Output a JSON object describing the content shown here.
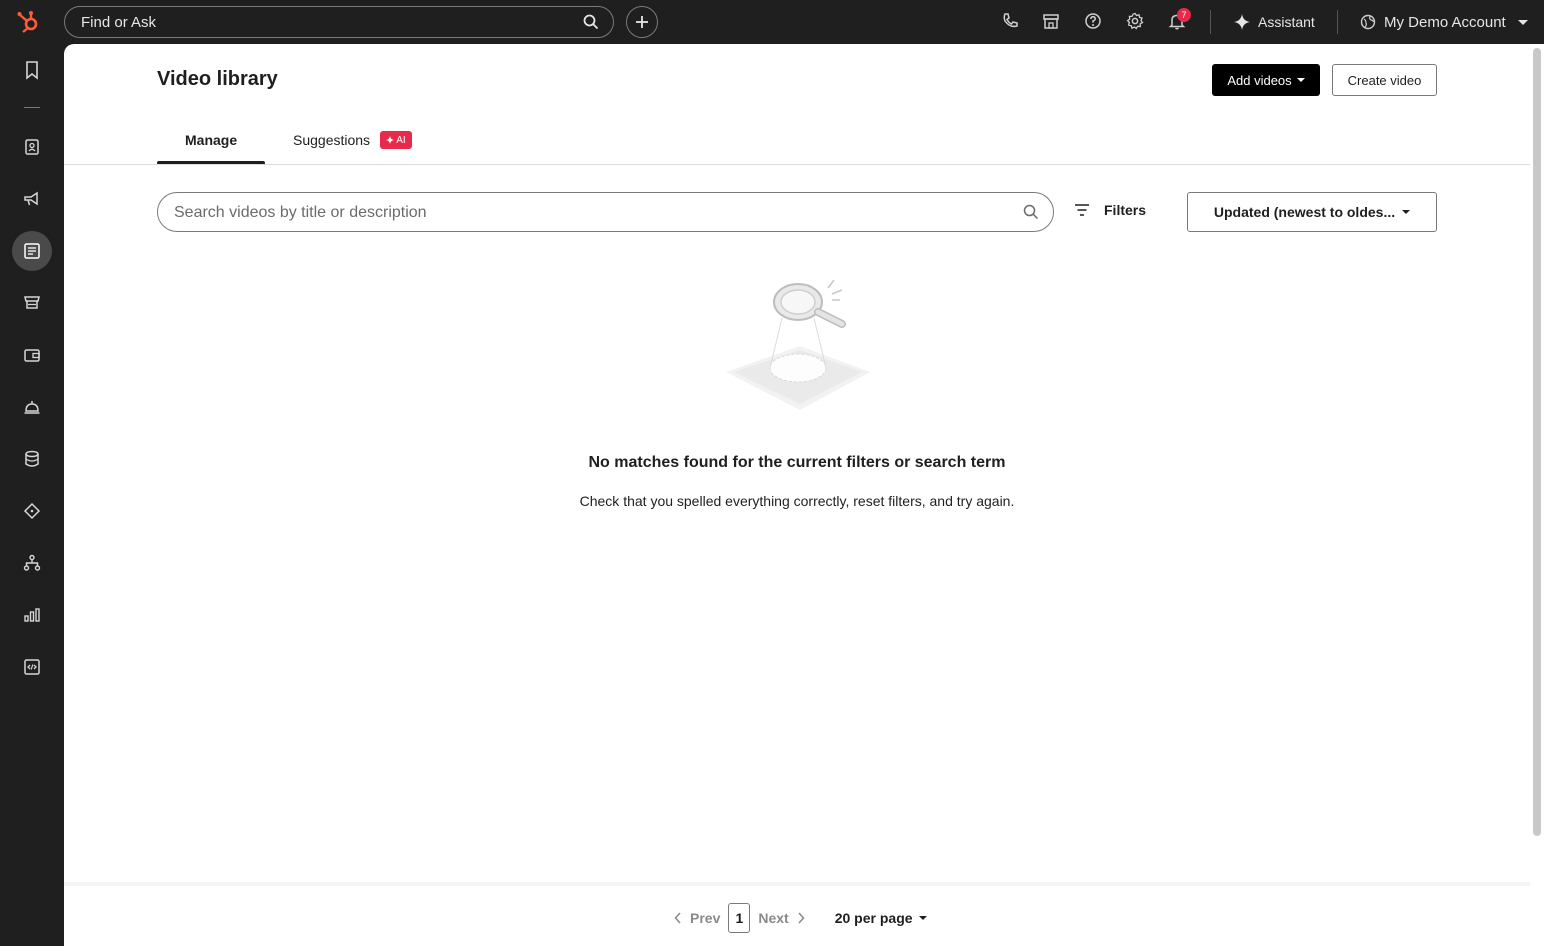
{
  "topbar": {
    "search_placeholder": "Find or Ask",
    "notification_count": "7",
    "assistant_label": "Assistant",
    "account_label": "My Demo Account"
  },
  "page": {
    "title": "Video library",
    "add_videos_label": "Add videos",
    "create_video_label": "Create video"
  },
  "tabs": [
    {
      "label": "Manage",
      "active": true
    },
    {
      "label": "Suggestions",
      "badge": "AI"
    }
  ],
  "toolbar": {
    "search_placeholder": "Search videos by title or description",
    "filters_label": "Filters",
    "sort_label": "Updated (newest to oldes..."
  },
  "empty_state": {
    "title": "No matches found for the current filters or search term",
    "subtitle": "Check that you spelled everything correctly, reset filters, and try again."
  },
  "pagination": {
    "prev_label": "Prev",
    "current_page": "1",
    "next_label": "Next",
    "per_page_label": "20 per page"
  },
  "colors": {
    "brand_accent": "#ff5c35",
    "badge_pink": "#e8294c",
    "topbar_bg": "#1f1f1f"
  },
  "icons": {
    "sidebar": [
      "bookmark-icon",
      "contacts-icon",
      "marketing-megaphone-icon",
      "content-icon",
      "commerce-icon",
      "wallet-icon",
      "service-bell-icon",
      "data-icon",
      "automation-icon",
      "workflows-icon",
      "reports-icon",
      "developer-icon"
    ]
  }
}
